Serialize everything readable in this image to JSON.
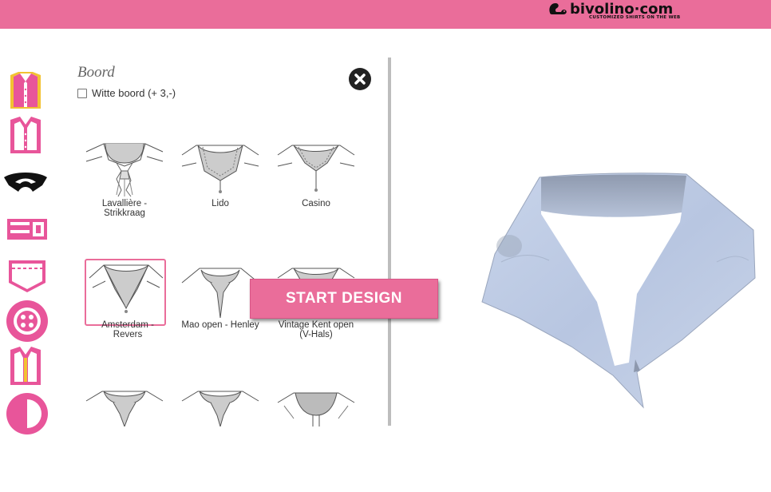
{
  "brand": {
    "name": "bivolino·com",
    "tagline": "CUSTOMIZED SHIRTS ON THE WEB"
  },
  "sidebar": {
    "items": [
      {
        "name": "shirt-style-icon",
        "active": true
      },
      {
        "name": "shirt-fit-icon"
      },
      {
        "name": "collar-icon"
      },
      {
        "name": "cuff-icon"
      },
      {
        "name": "pocket-icon"
      },
      {
        "name": "button-icon"
      },
      {
        "name": "shirt-placket-icon"
      },
      {
        "name": "contrast-icon"
      }
    ]
  },
  "panel": {
    "title": "Boord",
    "white_collar_label": "Witte boord (+ 3,-)",
    "white_collar_checked": false,
    "options": [
      {
        "label": "Lavallière - Strikkraag"
      },
      {
        "label": "Lido"
      },
      {
        "label": "Casino"
      },
      {
        "label": "Amsterdam - Revers",
        "selected": true
      },
      {
        "label": "Mao open - Henley"
      },
      {
        "label": "Vintage Kent open (V-Hals)"
      },
      {
        "label": ""
      },
      {
        "label": ""
      },
      {
        "label": ""
      }
    ]
  },
  "start_button": {
    "label": "START DESIGN"
  },
  "colors": {
    "brand_pink": "#ea6d9a",
    "collar_blue": "#bfcde6"
  }
}
